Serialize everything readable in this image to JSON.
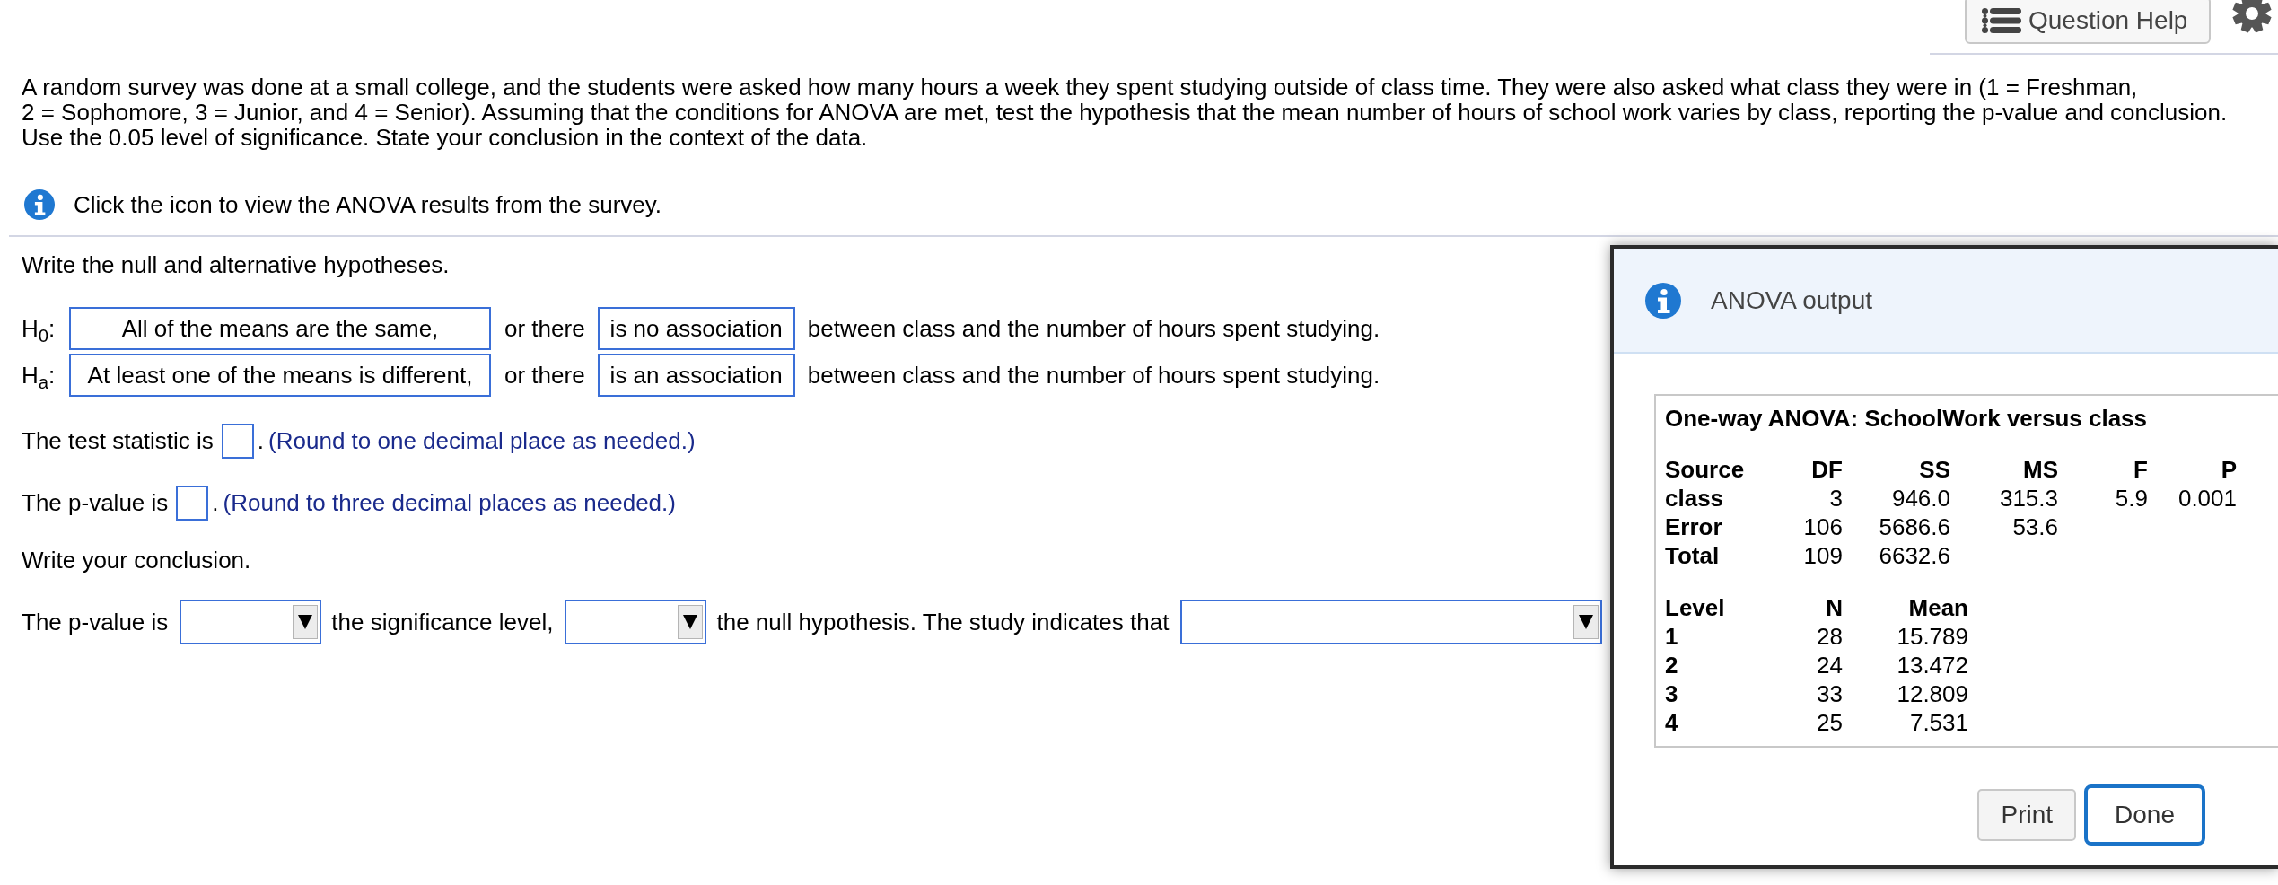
{
  "toolbar": {
    "help_button": "Question Help"
  },
  "problem": {
    "text": "A random survey was done at a small college, and the students were asked how many hours a week they spent studying outside of class time. They were also asked what class they were in (1 = Freshman, 2 = Sophomore, 3 = Junior, and 4 = Senior). Assuming that the conditions for ANOVA are met, test the hypothesis that the mean number of hours of school work varies by class, reporting the p-value and conclusion. Use the 0.05 level of significance. State your conclusion in the context of the data.",
    "info_prompt": "Click the icon to view the ANOVA results from the survey."
  },
  "hypotheses": {
    "prompt": "Write the null and alternative hypotheses.",
    "rows": [
      {
        "label": "H$_{0}$:",
        "answer": "All of the means are the same,",
        "connector": "or there",
        "choice": "is no association",
        "statement": "between class and the number of hours spent studying."
      },
      {
        "label": "H$_{a}$:",
        "answer": "At least one of the means is different,",
        "connector": "or there",
        "choice": "is an association",
        "statement": "between class and the number of hours spent studying."
      }
    ]
  },
  "answer_lines": [
    {
      "label": "The test statistic is",
      "after": ".",
      "hint": "(Round to one decimal place as needed.)"
    },
    {
      "label": "The p-value is",
      "after": ".",
      "hint": "(Round to three decimal places as needed.)"
    }
  ],
  "conclusion": {
    "prompt": "Write your conclusion.",
    "parts": [
      {
        "kind": "text",
        "text": "The p-value is"
      },
      {
        "kind": "dropdown"
      },
      {
        "kind": "text",
        "text": "the significance level,"
      },
      {
        "kind": "dropdown"
      },
      {
        "kind": "text",
        "text": "the null hypothesis. The study indicates that"
      },
      {
        "kind": "dropdown"
      }
    ]
  },
  "dialog": {
    "title": "ANOVA output",
    "output_title": "One-way ANOVA: SchoolWork versus class",
    "anova_table": {
      "columns": [
        "Source",
        "DF",
        "SS",
        "MS",
        "F",
        "P"
      ],
      "rows": [
        [
          "class",
          "3",
          "946.0",
          "315.3",
          "5.9",
          "0.001"
        ],
        [
          "Error",
          "106",
          "5686.6",
          "53.6"
        ],
        [
          "Total",
          "109",
          "6632.6"
        ]
      ]
    },
    "means_table": {
      "columns": [
        "Level",
        "N",
        "Mean"
      ],
      "rows": [
        [
          "1",
          "28",
          "15.789"
        ],
        [
          "2",
          "24",
          "13.472"
        ],
        [
          "3",
          "33",
          "12.809"
        ],
        [
          "4",
          "25",
          "7.531"
        ]
      ]
    },
    "buttons": [
      {
        "label": "Print",
        "focused": false
      },
      {
        "label": "Done",
        "focused": true
      }
    ]
  }
}
